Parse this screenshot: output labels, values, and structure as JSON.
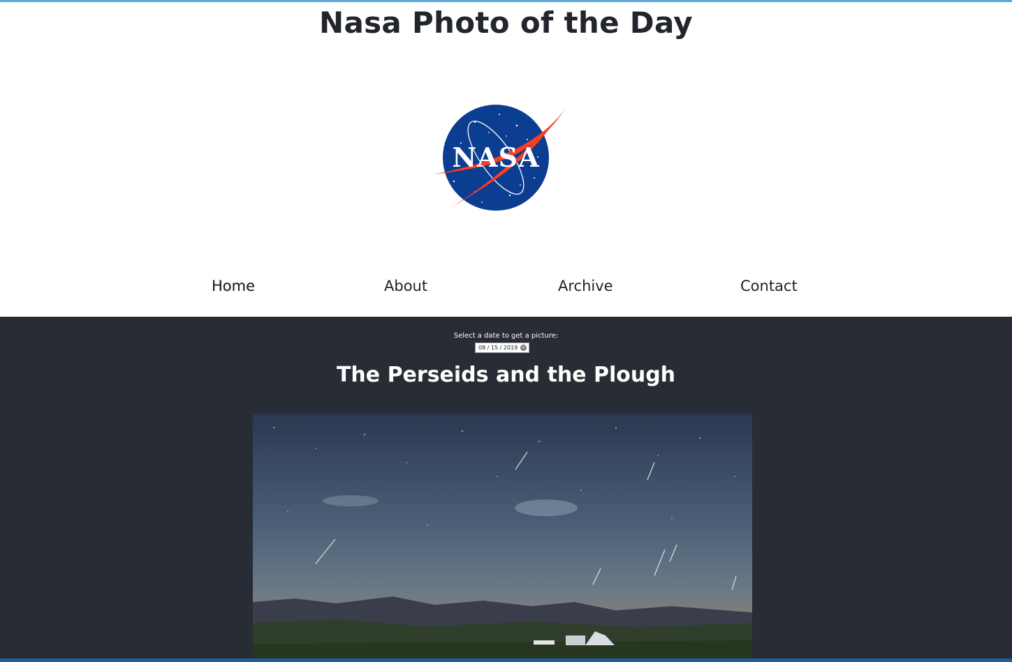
{
  "header": {
    "title": "Nasa Photo of the Day",
    "logo_text": "NASA"
  },
  "nav": {
    "items": [
      {
        "label": "Home"
      },
      {
        "label": "About"
      },
      {
        "label": "Archive"
      },
      {
        "label": "Contact"
      }
    ]
  },
  "date_picker": {
    "prompt": "Select a date to get a picture:",
    "value": "08 / 15 / 2019",
    "clear_icon": "clear-icon"
  },
  "picture": {
    "title": "The Perseids and the Plough"
  },
  "colors": {
    "header_bg": "#ffffff",
    "main_bg": "#282c34",
    "nasa_blue": "#0b3d91",
    "nasa_red": "#fc3d21"
  }
}
